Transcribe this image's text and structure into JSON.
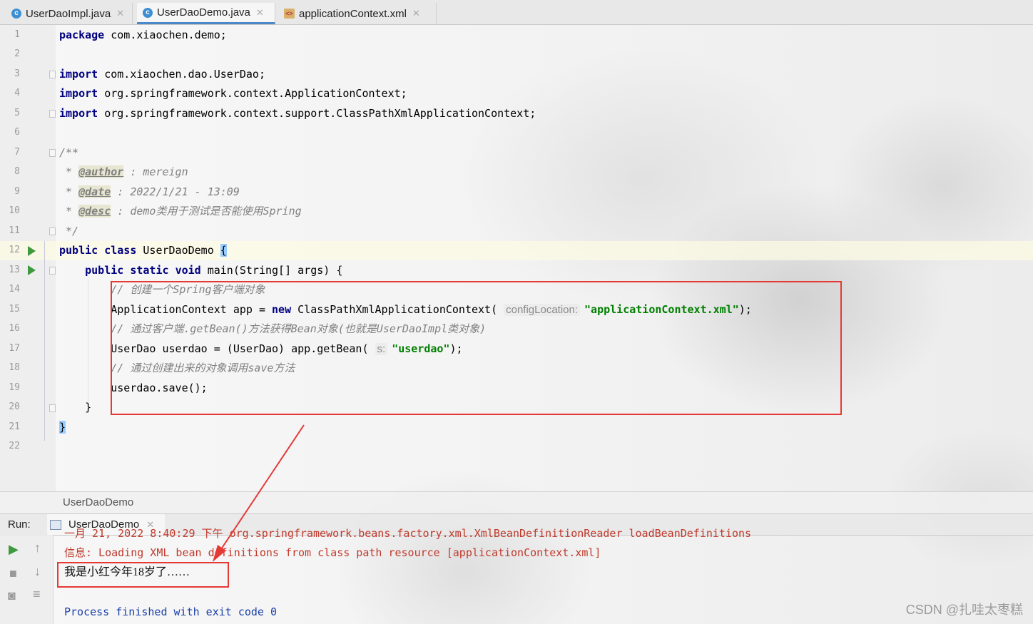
{
  "tabs": [
    {
      "label": "UserDaoImpl.java",
      "icon": "java-class-icon"
    },
    {
      "label": "UserDaoDemo.java",
      "icon": "java-class-icon"
    },
    {
      "label": "applicationContext.xml",
      "icon": "xml-file-icon"
    }
  ],
  "editor": {
    "line_numbers": [
      "1",
      "2",
      "3",
      "4",
      "5",
      "6",
      "7",
      "8",
      "9",
      "10",
      "11",
      "12",
      "13",
      "14",
      "15",
      "16",
      "17",
      "18",
      "19",
      "20",
      "21",
      "22"
    ],
    "code": {
      "l1_kw": "package",
      "l1_rest": " com.xiaochen.demo;",
      "l3_kw": "import",
      "l3_rest": " com.xiaochen.dao.UserDao;",
      "l4_kw": "import",
      "l4_rest": " org.springframework.context.ApplicationContext;",
      "l5_kw": "import",
      "l5_rest": " org.springframework.context.support.ClassPathXmlApplicationContext;",
      "l7": "/**",
      "l8_pre": " * ",
      "l8_tag": "@author",
      "l8_rest": " : mereign",
      "l9_pre": " * ",
      "l9_tag": "@date",
      "l9_rest": " : 2022/1/21 - 13:09",
      "l10_pre": " * ",
      "l10_tag": "@desc",
      "l10_rest": " : demo类用于测试是否能使用Spring",
      "l11": " */",
      "l12_kw1": "public",
      "l12_kw2": "class",
      "l12_name": " UserDaoDemo ",
      "l12_brace": "{",
      "l13_indent": "    ",
      "l13_kw1": "public",
      "l13_kw2": "static",
      "l13_kw3": "void",
      "l13_rest": " main(String[] args) {",
      "l14": "        // 创建一个Spring客户端对象",
      "l15_pre": "        ApplicationContext app = ",
      "l15_kw": "new",
      "l15_mid": " ClassPathXmlApplicationContext( ",
      "l15_hint": "configLocation:",
      "l15_str": "\"applicationContext.xml\"",
      "l15_end": ");",
      "l16": "        // 通过客户端.getBean()方法获得Bean对象(也就是UserDaoImpl类对象)",
      "l17_pre": "        UserDao userdao = (UserDao) app.getBean( ",
      "l17_hint": "s:",
      "l17_str": "\"userdao\"",
      "l17_end": ");",
      "l18": "        // 通过创建出来的对象调用save方法",
      "l19": "        userdao.save();",
      "l20": "    }",
      "l21": "}"
    }
  },
  "breadcrumb": "UserDaoDemo",
  "run_panel": {
    "label": "Run:",
    "tab": "UserDaoDemo",
    "console": {
      "cut_line": "一月 21, 2022 8:40:29 下午 org.springframework.beans.factory.xml.XmlBeanDefinitionReader loadBeanDefinitions",
      "info_line": "信息: Loading XML bean definitions from class path resource [applicationContext.xml]",
      "output_line": "我是小红今年18岁了……",
      "process_line": "Process finished with exit code 0"
    }
  },
  "watermark": "CSDN @扎哇太枣糕",
  "colors": {
    "annotation_box": "#e53935",
    "keyword": "#000080",
    "string": "#008000",
    "error_text": "#c0392b"
  }
}
